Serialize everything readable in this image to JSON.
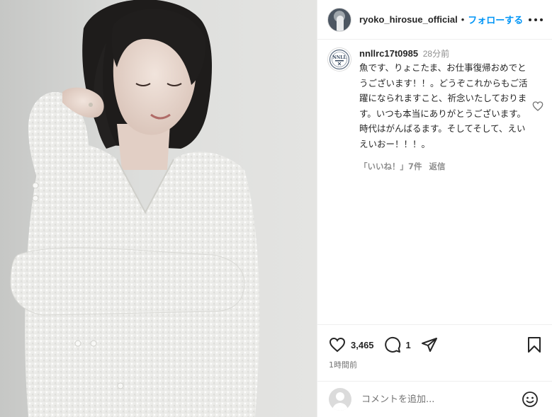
{
  "owner": {
    "username": "ryoko_hirosue_official",
    "separator": "•",
    "follow_label": "フォローする"
  },
  "comment": {
    "username": "nnllrc17t0985",
    "time": "28分前",
    "text": "魚です、りょこたま、お仕事復帰おめでとうございます！！。どうぞこれからもご活躍になられますこと、祈念いたしております。いつも本当にありがとうございます。時代はがんばるます。そしてそして、えいえいおー！！！。",
    "likes_label": "「いいね！」7件",
    "reply_label": "返信",
    "avatar_text": "NNLL"
  },
  "stats": {
    "likes_count": "3,465",
    "comments_count": "1",
    "posted_ago": "1時間前"
  },
  "add_comment": {
    "placeholder": "コメントを追加..."
  },
  "icons": {
    "more": "more-horizontal-icon",
    "heart": "heart-icon",
    "comment": "comment-icon",
    "share": "share-icon",
    "bookmark": "bookmark-icon",
    "emoji": "emoji-icon"
  }
}
